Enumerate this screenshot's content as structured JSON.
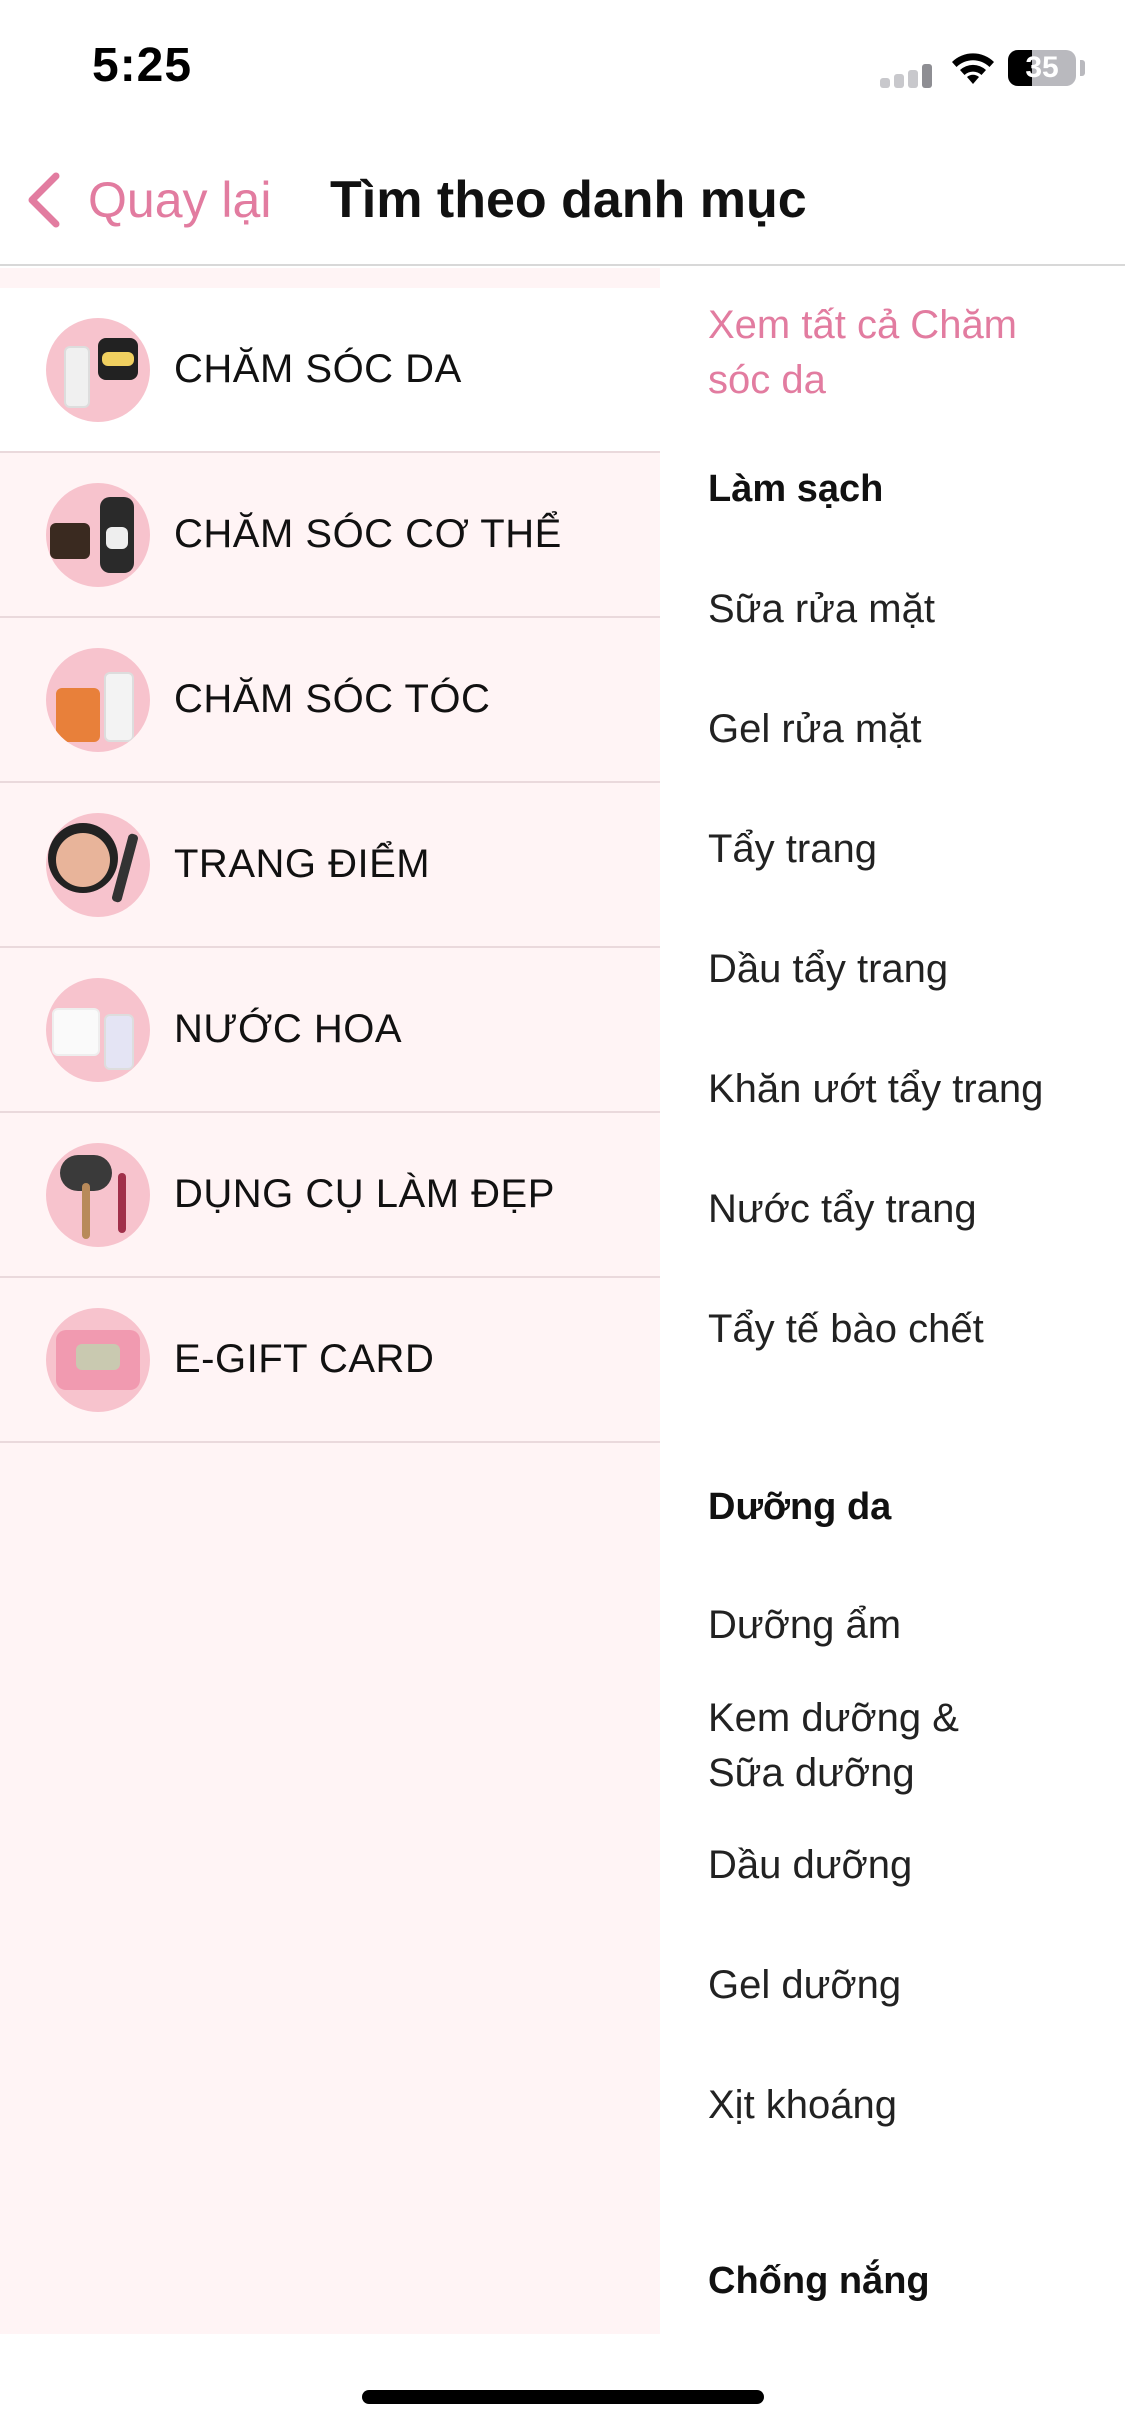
{
  "status_bar": {
    "time": "5:25",
    "battery": "35",
    "icons": [
      "cellular-signal-icon",
      "wifi-icon",
      "battery-icon"
    ]
  },
  "nav": {
    "back_label": "Quay lại",
    "title": "Tìm theo danh mục"
  },
  "categories": [
    {
      "label": "CHĂM SÓC DA",
      "active": true
    },
    {
      "label": "CHĂM SÓC CƠ THỂ",
      "active": false
    },
    {
      "label": "CHĂM SÓC TÓC",
      "active": false
    },
    {
      "label": "TRANG ĐIỂM",
      "active": false
    },
    {
      "label": "NƯỚC HOA",
      "active": false
    },
    {
      "label": "DỤNG CỤ LÀM ĐẸP",
      "active": false
    },
    {
      "label": "E-GIFT CARD",
      "active": false
    }
  ],
  "right": {
    "see_all": "Xem tất cả Chăm sóc da",
    "sections": [
      {
        "heading": "Làm sạch",
        "items": [
          "Sữa rửa mặt",
          "Gel rửa mặt",
          "Tẩy trang",
          "Dầu tẩy trang",
          "Khăn ướt tẩy trang",
          "Nước tẩy trang",
          "Tẩy tế bào chết"
        ]
      },
      {
        "heading": "Dưỡng da",
        "items": [
          "Dưỡng ẩm",
          "Kem dưỡng & Sữa dưỡng",
          "Dầu dưỡng",
          "Gel dưỡng",
          "Xịt khoáng"
        ]
      },
      {
        "heading": "Chống nắng",
        "items": []
      }
    ]
  },
  "colors": {
    "accent": "#e27ca0",
    "left_bg": "#fff4f5",
    "thumb_bg": "#f7c3cd"
  }
}
